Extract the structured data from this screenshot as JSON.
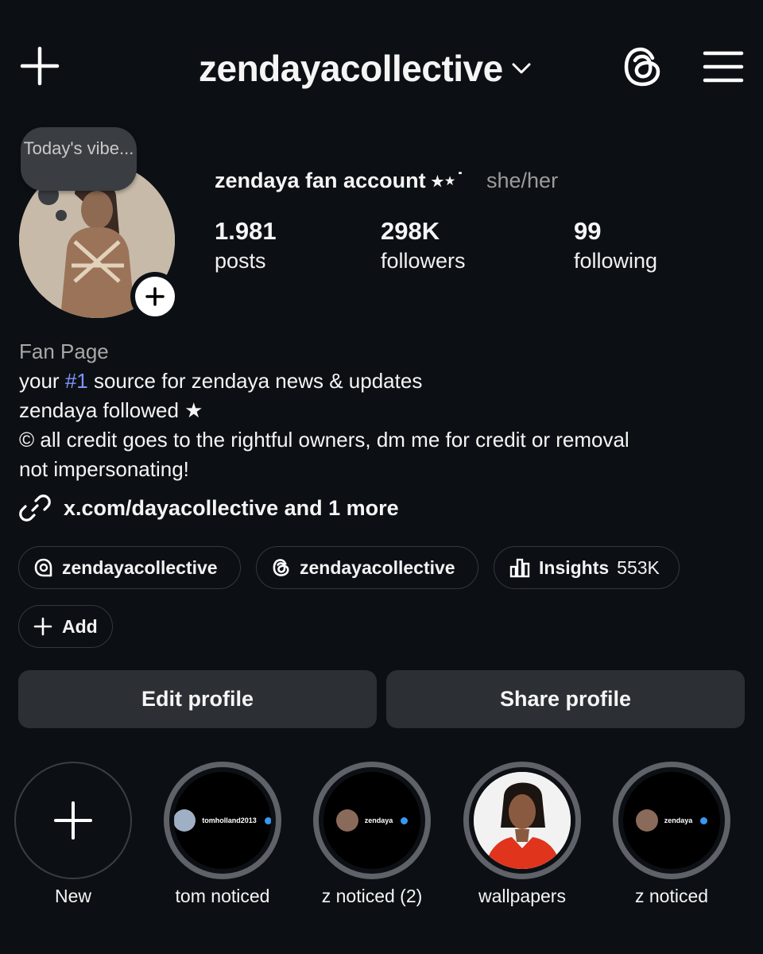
{
  "header": {
    "username": "zendayacollective",
    "icons": [
      "plus-icon",
      "chevron-down-icon",
      "threads-icon",
      "menu-icon"
    ]
  },
  "note": {
    "text": "Today's vibe..."
  },
  "profile": {
    "display_name": "zendaya fan account ⭒⋆˙",
    "pronouns": "she/her",
    "stats": [
      {
        "value": "1.981",
        "label": "posts"
      },
      {
        "value": "298K",
        "label": "followers"
      },
      {
        "value": "99",
        "label": "following"
      }
    ]
  },
  "bio": {
    "category": "Fan Page",
    "line1_prefix": "your ",
    "line1_hashtag": "#1",
    "line1_suffix": " source for zendaya news & updates",
    "line2": "zendaya followed ★",
    "line3": "© all credit goes to the rightful owners, dm me for credit or removal",
    "line4": "not impersonating!",
    "link": "x.com/dayacollective and 1 more"
  },
  "chips": [
    {
      "label": "zendayacollective",
      "icon": "threads-chat-icon"
    },
    {
      "label": "zendayacollective",
      "icon": "threads-icon"
    },
    {
      "label": "Insights",
      "sub": "553K",
      "icon": "insights-icon"
    },
    {
      "label": "Add",
      "icon": "plus-icon"
    }
  ],
  "actions": {
    "edit": "Edit profile",
    "share": "Share profile"
  },
  "highlights": [
    {
      "label": "New"
    },
    {
      "label": "tom noticed",
      "inner_text": "tomholland2013"
    },
    {
      "label": "z noticed (2)",
      "inner_text": "zendaya"
    },
    {
      "label": "wallpapers"
    },
    {
      "label": "z noticed",
      "inner_text": "zendaya"
    }
  ],
  "colors": {
    "background": "#0c1014",
    "button": "#2c3035",
    "hashtag": "#7f93ff",
    "accent_red": "#e0341c"
  }
}
